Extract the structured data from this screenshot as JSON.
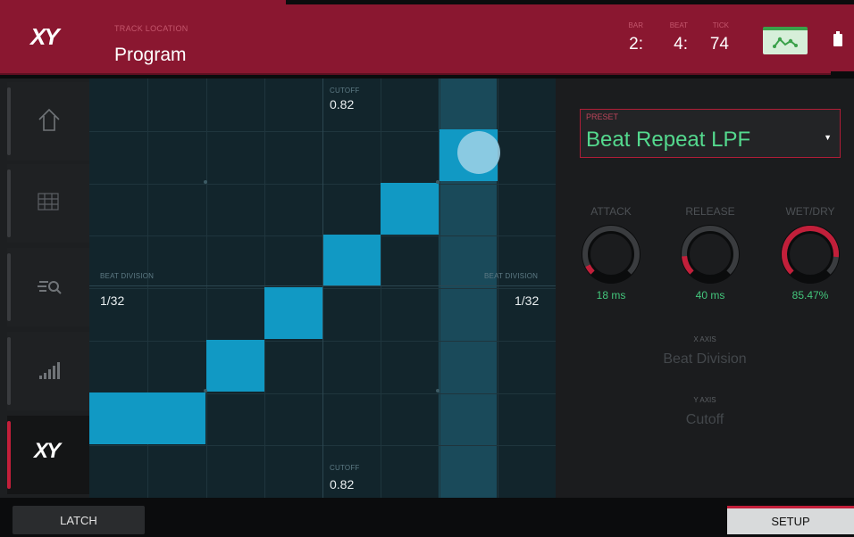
{
  "header": {
    "logo": "XY",
    "track_location_label": "TRACK LOCATION",
    "track_location_value": "Program",
    "bar_label": "BAR",
    "bar_value": "2:",
    "beat_label": "BEAT",
    "beat_value": "4:",
    "tick_label": "TICK",
    "tick_value": "74",
    "automation_icon": "automation-icon",
    "battery_icon": "battery-icon",
    "accent_color": "#8a1730"
  },
  "sidebar": {
    "items": [
      {
        "icon": "home-icon",
        "active": false
      },
      {
        "icon": "grid-icon",
        "active": false
      },
      {
        "icon": "browser-icon",
        "active": false
      },
      {
        "icon": "levels-icon",
        "active": false
      },
      {
        "icon": "xy-icon",
        "label": "XY",
        "active": true
      }
    ]
  },
  "pad": {
    "top_label": "CUTOFF",
    "top_value": "0.82",
    "bottom_label": "CUTOFF",
    "bottom_value": "0.82",
    "left_label": "BEAT DIVISION",
    "left_value": "1/32",
    "right_label": "BEAT DIVISION",
    "right_value": "1/32",
    "cell_color": "#1199c4",
    "active_steps": [
      [
        0,
        6
      ],
      [
        1,
        6
      ],
      [
        2,
        5
      ],
      [
        3,
        4
      ],
      [
        4,
        3
      ],
      [
        5,
        2
      ],
      [
        6,
        1
      ]
    ]
  },
  "panel": {
    "preset_label": "PRESET",
    "preset_value": "Beat Repeat LPF",
    "knobs": [
      {
        "label": "ATTACK",
        "value": "18 ms",
        "level": 0.07,
        "color": "#c21f3a"
      },
      {
        "label": "RELEASE",
        "value": "40 ms",
        "level": 0.15,
        "color": "#c21f3a"
      },
      {
        "label": "WET/DRY",
        "value": "85.47%",
        "level": 0.8547,
        "color": "#c21f3a"
      }
    ],
    "x_axis_label": "X AXIS",
    "x_axis_value": "Beat Division",
    "y_axis_label": "Y AXIS",
    "y_axis_value": "Cutoff"
  },
  "footer": {
    "latch_label": "LATCH",
    "setup_label": "SETUP"
  }
}
